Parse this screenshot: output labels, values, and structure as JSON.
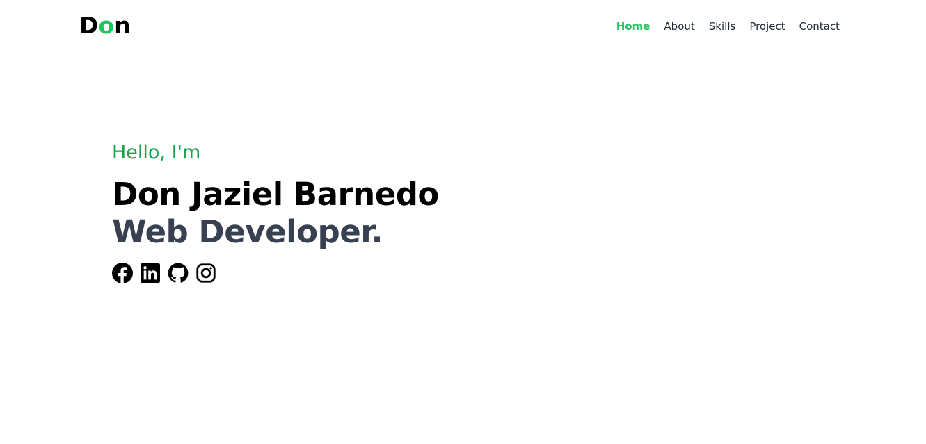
{
  "header": {
    "logo": {
      "first": "D",
      "accent": "o",
      "last": "n"
    },
    "nav": [
      {
        "label": "Home",
        "active": true
      },
      {
        "label": "About",
        "active": false
      },
      {
        "label": "Skills",
        "active": false
      },
      {
        "label": "Project",
        "active": false
      },
      {
        "label": "Contact",
        "active": false
      }
    ]
  },
  "hero": {
    "greeting": "Hello, I'm",
    "name": "Don Jaziel Barnedo",
    "role": "Web Developer.",
    "socials": [
      {
        "icon": "facebook-icon"
      },
      {
        "icon": "linkedin-icon"
      },
      {
        "icon": "github-icon"
      },
      {
        "icon": "instagram-icon"
      }
    ]
  },
  "colors": {
    "accent": "#22c55e",
    "greeting": "#16a34a",
    "name": "#000000",
    "role": "#374151",
    "nav_text": "#1f2937"
  }
}
